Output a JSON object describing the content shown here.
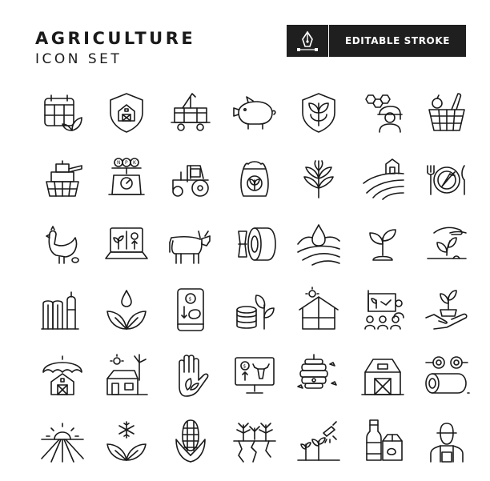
{
  "header": {
    "title": "AGRICULTURE",
    "subtitle": "ICON SET",
    "badge_label": "EDITABLE STROKE",
    "badge_icon": "pen-nib-icon"
  },
  "colors": {
    "ink": "#1a1a1a",
    "background": "#ffffff",
    "badge": "#1f1f1f"
  },
  "icons": [
    [
      "calendar-leaf-icon",
      "shield-barn-icon",
      "mine-cart-icon",
      "pig-icon",
      "shield-plant-icon",
      "beekeeper-icon",
      "picnic-basket-icon"
    ],
    [
      "combine-harvester-icon",
      "npk-scale-icon",
      "tractor-icon",
      "fertilizer-sack-icon",
      "wheat-plant-icon",
      "barn-hill-fields-icon",
      "plate-carrot-icon"
    ],
    [
      "hen-egg-icon",
      "laptop-plant-growth-icon",
      "cow-icon",
      "hay-bale-icon",
      "water-drop-fields-icon",
      "seedling-icon",
      "hand-seedling-icon"
    ],
    [
      "grain-silos-icon",
      "water-drop-leaves-icon",
      "phone-money-pig-icon",
      "coins-plant-icon",
      "greenhouse-sun-icon",
      "farm-presentation-icon",
      "hand-plant-icon"
    ],
    [
      "umbrella-barn-icon",
      "barn-windmill-sun-icon",
      "hand-leaf-icon",
      "monitor-cattle-price-icon",
      "beehive-icon",
      "barn-icon",
      "hay-rolls-icon"
    ],
    [
      "sunrise-field-icon",
      "snowflake-leaves-icon",
      "corn-cob-icon",
      "drought-crops-icon",
      "irrigation-sprinkler-icon",
      "milk-bottles-icon",
      "farmer-icon"
    ]
  ],
  "npk_letters": [
    "N",
    "P",
    "K"
  ],
  "currency_symbol": "$"
}
